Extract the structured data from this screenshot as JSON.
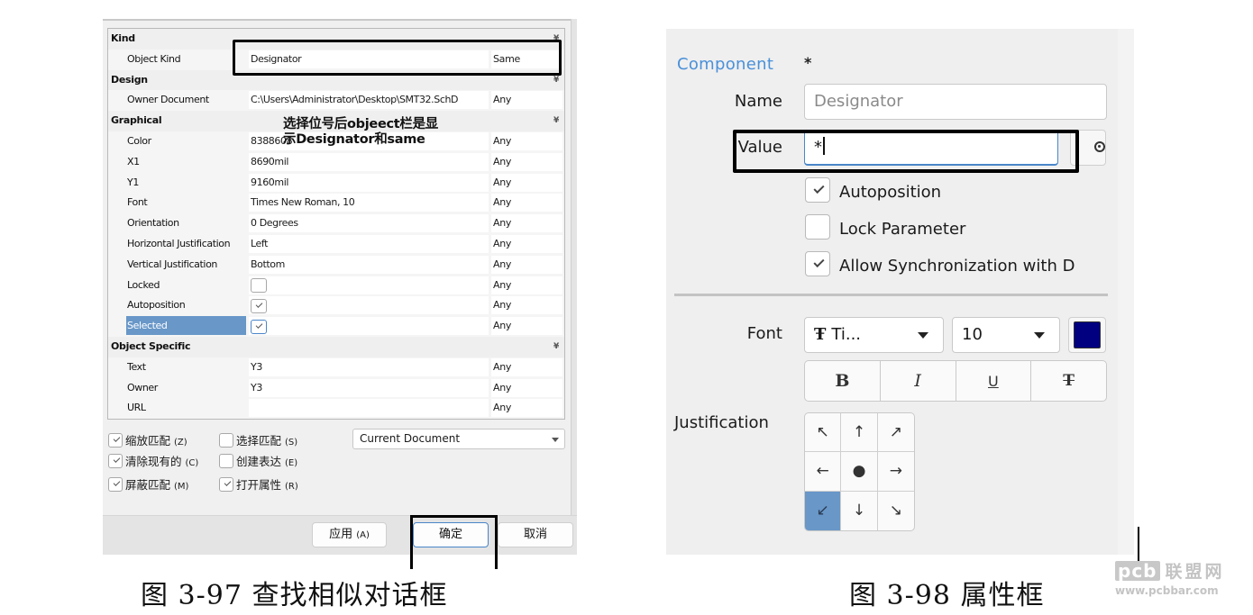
{
  "find_similar_dialog": {
    "categories": [
      {
        "label": "Kind",
        "properties": [
          {
            "name": "Object Kind",
            "value": "Designator",
            "match": "Same"
          }
        ]
      },
      {
        "label": "Design",
        "properties": [
          {
            "name": "Owner Document",
            "value": "C:\\Users\\Administrator\\Desktop\\SMT32.SchD",
            "match": "Any"
          }
        ]
      },
      {
        "label": "Graphical",
        "properties": [
          {
            "name": "Color",
            "value": "8388608",
            "match": "Any"
          },
          {
            "name": "X1",
            "value": "8690mil",
            "match": "Any"
          },
          {
            "name": "Y1",
            "value": "9160mil",
            "match": "Any"
          },
          {
            "name": "Font",
            "value": "Times New Roman, 10",
            "match": "Any"
          },
          {
            "name": "Orientation",
            "value": "0 Degrees",
            "match": "Any"
          },
          {
            "name": "Horizontal Justification",
            "value": "Left",
            "match": "Any"
          },
          {
            "name": "Vertical Justification",
            "value": "Bottom",
            "match": "Any"
          },
          {
            "name": "Locked",
            "checked": false,
            "match": "Any"
          },
          {
            "name": "Autoposition",
            "checked": true,
            "match": "Any"
          },
          {
            "name": "Selected",
            "checked": true,
            "match": "Any",
            "selected": true
          }
        ]
      },
      {
        "label": "Object Specific",
        "properties": [
          {
            "name": "Text",
            "value": "Y3",
            "match": "Any"
          },
          {
            "name": "Owner",
            "value": "Y3",
            "match": "Any"
          },
          {
            "name": "URL",
            "value": "",
            "match": "Any"
          }
        ]
      }
    ],
    "annotation_line1": "选择位号后objeect栏是显",
    "annotation_line2": "示Designator和same",
    "options": [
      {
        "label": "缩放匹配",
        "mnemonic": "(Z)",
        "checked": true
      },
      {
        "label": "选择匹配",
        "mnemonic": "(S)",
        "checked": false
      },
      {
        "label": "清除现有的",
        "mnemonic": "(C)",
        "checked": true
      },
      {
        "label": "创建表达",
        "mnemonic": "(E)",
        "checked": false
      },
      {
        "label": "屏蔽匹配",
        "mnemonic": "(M)",
        "checked": true
      },
      {
        "label": "打开属性",
        "mnemonic": "(R)",
        "checked": true
      }
    ],
    "scope": "Current Document",
    "buttons": {
      "apply": "应用",
      "apply_mnemonic": "(A)",
      "ok": "确定",
      "cancel": "取消"
    },
    "caption": "图 3-97 查找相似对话框"
  },
  "properties_panel": {
    "section_label": "Component",
    "section_value": "*",
    "name_label": "Name",
    "name_placeholder": "Designator",
    "value_label": "Value",
    "value_text": "*",
    "checkboxes": [
      {
        "label": "Autoposition",
        "checked": true
      },
      {
        "label": "Lock Parameter",
        "checked": false
      },
      {
        "label": "Allow Synchronization with D",
        "checked": true
      }
    ],
    "font_label": "Font",
    "font_family": "Ti...",
    "font_size": "10",
    "font_color": "#000080",
    "format_buttons": [
      "B",
      "I",
      "U",
      "T"
    ],
    "justification_label": "Justification",
    "justification_cells": [
      "↖",
      "↑",
      "↗",
      "←",
      "●",
      "→",
      "↙",
      "↓",
      "↘"
    ],
    "justification_selected": 6,
    "caption": "图 3-98 属性框"
  },
  "watermark": {
    "logo": "pcb",
    "name": "联盟网",
    "url": "www.pcbbar.com"
  }
}
